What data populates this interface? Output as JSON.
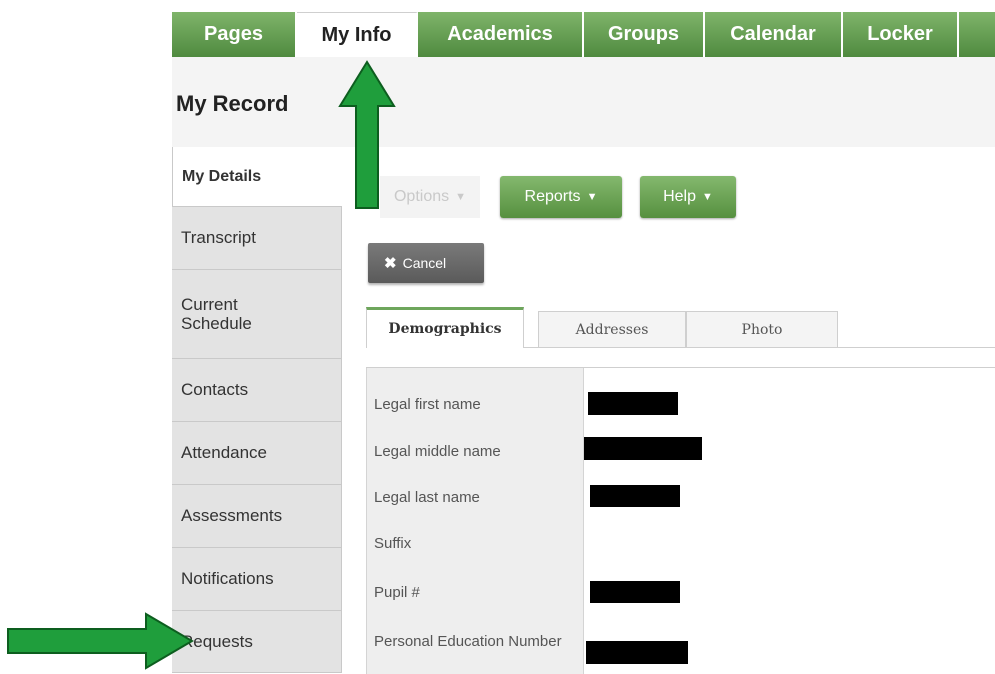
{
  "top_nav": {
    "tabs": [
      {
        "label": "Pages",
        "active": false
      },
      {
        "label": "My Info",
        "active": true
      },
      {
        "label": "Academics",
        "active": false
      },
      {
        "label": "Groups",
        "active": false
      },
      {
        "label": "Calendar",
        "active": false
      },
      {
        "label": "Locker",
        "active": false
      }
    ]
  },
  "page": {
    "title": "My Record"
  },
  "side_nav": {
    "items": [
      {
        "label": "My Details",
        "active": true
      },
      {
        "label": "Transcript"
      },
      {
        "label": "Current Schedule"
      },
      {
        "label": "Contacts"
      },
      {
        "label": "Attendance"
      },
      {
        "label": "Assessments"
      },
      {
        "label": "Notifications"
      },
      {
        "label": "Requests"
      }
    ]
  },
  "toolbar": {
    "options_label": "Options",
    "reports_label": "Reports",
    "help_label": "Help",
    "cancel_label": "Cancel"
  },
  "sub_tabs": [
    {
      "label": "Demographics",
      "active": true
    },
    {
      "label": "Addresses"
    },
    {
      "label": "Photo"
    }
  ],
  "form": {
    "fields": [
      {
        "label": "Legal first name",
        "value_redacted": true
      },
      {
        "label": "Legal middle name",
        "value_redacted": true
      },
      {
        "label": "Legal last name",
        "value_redacted": true
      },
      {
        "label": "Suffix",
        "value_redacted": false
      },
      {
        "label": "Pupil #",
        "value_redacted": true
      },
      {
        "label": "Personal Education Number",
        "value_redacted": true
      }
    ]
  },
  "colors": {
    "nav_green": "#5f9a4c",
    "arrow_green": "#1f9e3c",
    "cancel_gray": "#6a6a6a"
  },
  "icons": [
    "close-icon",
    "caret-down-icon",
    "arrow-up-icon",
    "arrow-right-icon"
  ]
}
